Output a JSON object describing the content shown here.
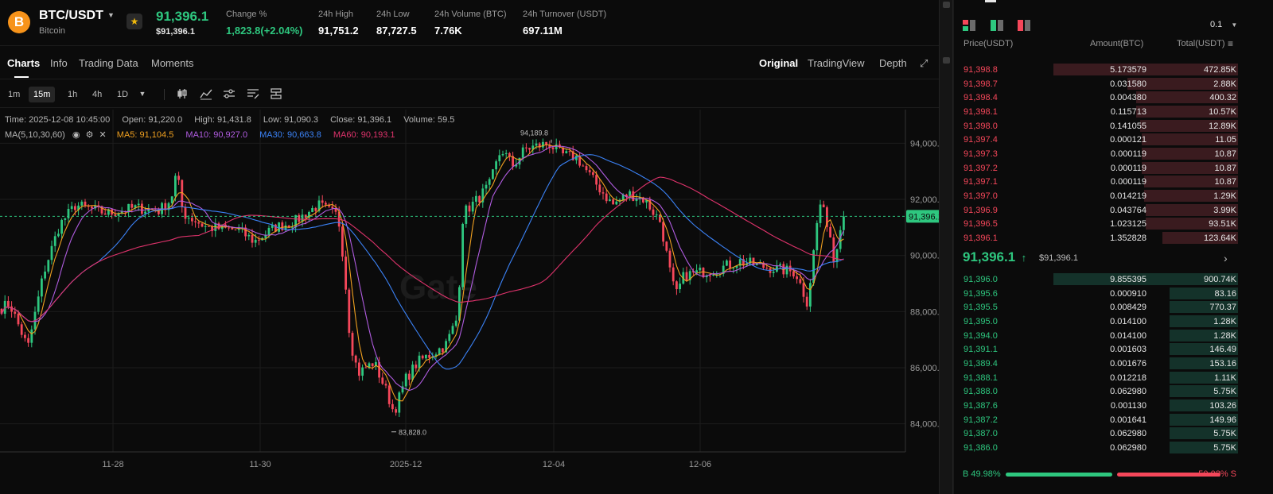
{
  "header": {
    "coin_icon": "B",
    "symbol": "BTC/USDT",
    "name": "Bitcoin",
    "last_price": "91,396.1",
    "last_price_usd": "$91,396.1",
    "stats": [
      {
        "label": "Change %",
        "value": "1,823.8(+2.04%)",
        "positive": true
      },
      {
        "label": "24h High",
        "value": "91,751.2"
      },
      {
        "label": "24h Low",
        "value": "87,727.5"
      },
      {
        "label": "24h Volume (BTC)",
        "value": "7.76K"
      },
      {
        "label": "24h Turnover (USDT)",
        "value": "697.11M"
      }
    ]
  },
  "tabs": [
    "Charts",
    "Info",
    "Trading Data",
    "Moments"
  ],
  "view_tabs": [
    "Original",
    "TradingView",
    "Depth"
  ],
  "intervals": [
    "1m",
    "15m",
    "1h",
    "4h",
    "1D"
  ],
  "active_interval": "15m",
  "tool_icons": [
    "candlestick-icon",
    "indicator-icon",
    "settings-sliders-icon",
    "drawing-list-icon",
    "layout-icon"
  ],
  "chart_info": {
    "time": "Time: 2025-12-08 10:45:00",
    "open": "Open: 91,220.0",
    "high": "High: 91,431.8",
    "low": "Low: 91,090.3",
    "close": "Close: 91,396.1",
    "volume": "Volume: 59.5",
    "ma_label": "MA(5,10,30,60)",
    "ma5": "MA5: 91,104.5",
    "ma10": "MA10: 90,927.0",
    "ma30": "MA30: 90,663.8",
    "ma60": "MA60: 90,193.1"
  },
  "colors": {
    "up": "#2ec77f",
    "down": "#f5475a",
    "ma5": "#f0a020",
    "ma10": "#b05ce0",
    "ma30": "#3b82f6",
    "ma60": "#e0336c",
    "brand": "#f7931a"
  },
  "chart_data": {
    "type": "candlestick",
    "watermark": "Gate",
    "current_price": 91396.1,
    "current_price_label": "91,396.1",
    "ylim": [
      83000,
      95200
    ],
    "y_ticks": [
      84000,
      86000,
      88000,
      90000,
      92000,
      94000
    ],
    "y_tick_labels": [
      "84,000.0",
      "86,000.0",
      "88,000.0",
      "90,000.0",
      "92,000.0",
      "94,000.0"
    ],
    "x_tick_labels": [
      "11-28",
      "11-30",
      "2025-12",
      "12-04",
      "12-06"
    ],
    "high_label": "94,189.8",
    "low_label": "83,828.0",
    "path": [
      [
        0,
        88100
      ],
      [
        12,
        88300
      ],
      [
        35,
        86700
      ],
      [
        55,
        89400
      ],
      [
        75,
        91100
      ],
      [
        95,
        91800
      ],
      [
        135,
        91500
      ],
      [
        170,
        91700
      ],
      [
        200,
        91600
      ],
      [
        215,
        92000
      ],
      [
        222,
        93000
      ],
      [
        230,
        91500
      ],
      [
        260,
        91000
      ],
      [
        300,
        90900
      ],
      [
        320,
        90500
      ],
      [
        345,
        91000
      ],
      [
        370,
        91200
      ],
      [
        400,
        91800
      ],
      [
        425,
        91400
      ],
      [
        432,
        89800
      ],
      [
        440,
        87000
      ],
      [
        450,
        85800
      ],
      [
        470,
        86200
      ],
      [
        485,
        85200
      ],
      [
        495,
        84400
      ],
      [
        510,
        85600
      ],
      [
        525,
        86200
      ],
      [
        560,
        86800
      ],
      [
        575,
        87800
      ],
      [
        582,
        91500
      ],
      [
        600,
        92000
      ],
      [
        615,
        92500
      ],
      [
        630,
        93800
      ],
      [
        645,
        93200
      ],
      [
        660,
        93800
      ],
      [
        690,
        94000
      ],
      [
        705,
        93600
      ],
      [
        725,
        93500
      ],
      [
        745,
        92700
      ],
      [
        770,
        91800
      ],
      [
        790,
        92200
      ],
      [
        810,
        92000
      ],
      [
        830,
        91200
      ],
      [
        845,
        89000
      ],
      [
        850,
        88600
      ],
      [
        860,
        89300
      ],
      [
        900,
        89500
      ],
      [
        930,
        89800
      ],
      [
        960,
        89600
      ],
      [
        1000,
        89400
      ],
      [
        1015,
        88300
      ],
      [
        1020,
        89500
      ],
      [
        1030,
        91900
      ],
      [
        1042,
        91000
      ],
      [
        1048,
        89800
      ],
      [
        1058,
        91400
      ],
      [
        1064,
        91396
      ]
    ]
  },
  "orderbook": {
    "tick_size": "0.1",
    "headers": [
      "Price(USDT)",
      "Amount(BTC)",
      "Total(USDT)"
    ],
    "asks": [
      {
        "price": "91,398.8",
        "amount": "5.173579",
        "total": "472.85K",
        "depth": 1.0
      },
      {
        "price": "91,398.7",
        "amount": "0.031580",
        "total": "2.88K",
        "depth": 0.6
      },
      {
        "price": "91,398.4",
        "amount": "0.004380",
        "total": "400.32",
        "depth": 0.55
      },
      {
        "price": "91,398.1",
        "amount": "0.115713",
        "total": "10.57K",
        "depth": 0.55
      },
      {
        "price": "91,398.0",
        "amount": "0.141055",
        "total": "12.89K",
        "depth": 0.53
      },
      {
        "price": "91,397.4",
        "amount": "0.000121",
        "total": "11.05",
        "depth": 0.52
      },
      {
        "price": "91,397.3",
        "amount": "0.000119",
        "total": "10.87",
        "depth": 0.52
      },
      {
        "price": "91,397.2",
        "amount": "0.000119",
        "total": "10.87",
        "depth": 0.52
      },
      {
        "price": "91,397.1",
        "amount": "0.000119",
        "total": "10.87",
        "depth": 0.51
      },
      {
        "price": "91,397.0",
        "amount": "0.014219",
        "total": "1.29K",
        "depth": 0.51
      },
      {
        "price": "91,396.9",
        "amount": "0.043764",
        "total": "3.99K",
        "depth": 0.5
      },
      {
        "price": "91,396.5",
        "amount": "1.023125",
        "total": "93.51K",
        "depth": 0.5
      },
      {
        "price": "91,396.1",
        "amount": "1.352828",
        "total": "123.64K",
        "depth": 0.41
      }
    ],
    "mid_price": "91,396.1",
    "mid_arrow": "↑",
    "mid_usd": "$91,396.1",
    "bids": [
      {
        "price": "91,396.0",
        "amount": "9.855395",
        "total": "900.74K",
        "depth": 1.0
      },
      {
        "price": "91,395.6",
        "amount": "0.000910",
        "total": "83.16",
        "depth": 0.37
      },
      {
        "price": "91,395.5",
        "amount": "0.008429",
        "total": "770.37",
        "depth": 0.37
      },
      {
        "price": "91,395.0",
        "amount": "0.014100",
        "total": "1.28K",
        "depth": 0.37
      },
      {
        "price": "91,394.0",
        "amount": "0.014100",
        "total": "1.28K",
        "depth": 0.37
      },
      {
        "price": "91,391.1",
        "amount": "0.001603",
        "total": "146.49",
        "depth": 0.37
      },
      {
        "price": "91,389.4",
        "amount": "0.001676",
        "total": "153.16",
        "depth": 0.37
      },
      {
        "price": "91,388.1",
        "amount": "0.012218",
        "total": "1.11K",
        "depth": 0.37
      },
      {
        "price": "91,388.0",
        "amount": "0.062980",
        "total": "5.75K",
        "depth": 0.37
      },
      {
        "price": "91,387.6",
        "amount": "0.001130",
        "total": "103.26",
        "depth": 0.37
      },
      {
        "price": "91,387.2",
        "amount": "0.001641",
        "total": "149.96",
        "depth": 0.37
      },
      {
        "price": "91,387.0",
        "amount": "0.062980",
        "total": "5.75K",
        "depth": 0.37
      },
      {
        "price": "91,386.0",
        "amount": "0.062980",
        "total": "5.75K",
        "depth": 0.37
      }
    ],
    "buy_label": "B 49.98%",
    "sell_label": "50.02% S",
    "buy_ratio": 0.4998
  }
}
